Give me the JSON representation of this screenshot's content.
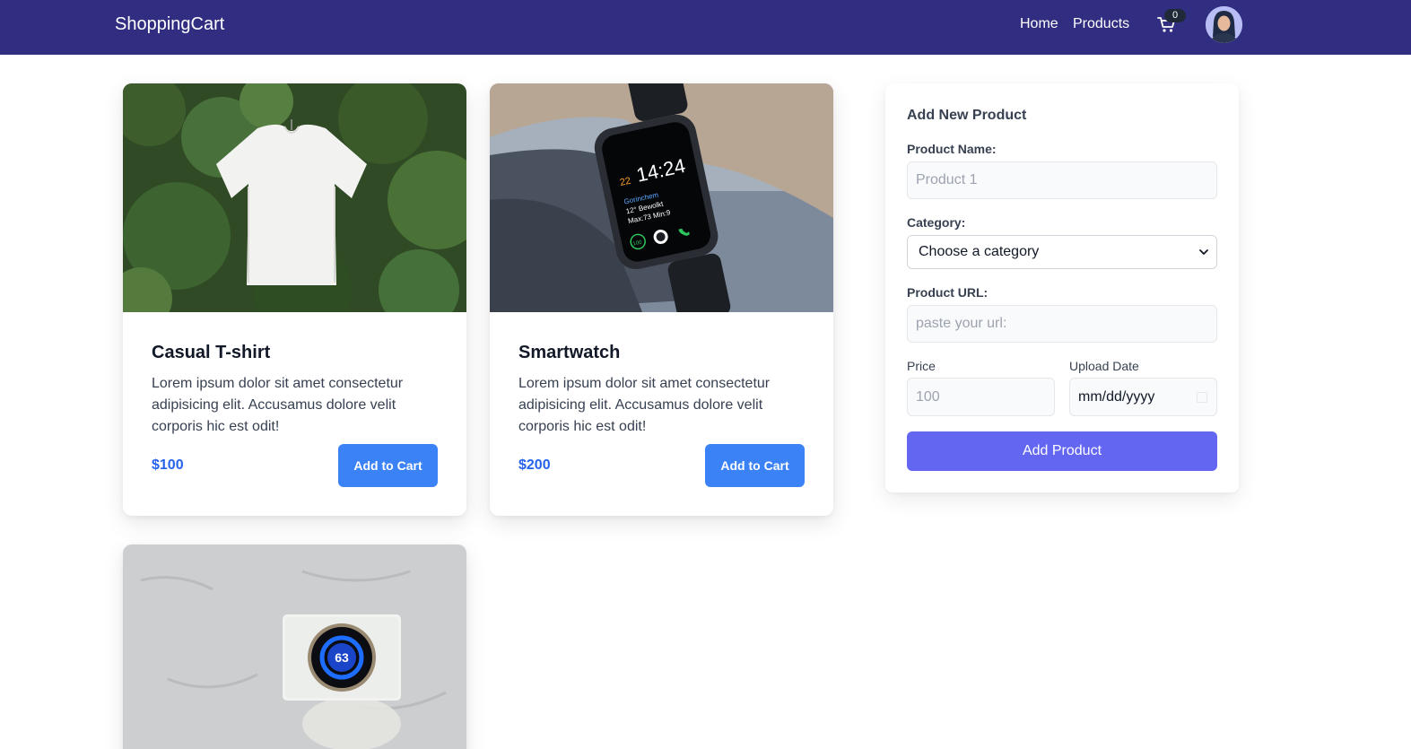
{
  "app": {
    "brand": "ShoppingCart"
  },
  "nav": {
    "links": [
      "Home",
      "Products"
    ],
    "cart_count": "0"
  },
  "products": [
    {
      "title": "Casual T-shirt",
      "description": "Lorem ipsum dolor sit amet consectetur adipisicing elit. Accusamus dolore velit corporis hic est odit!",
      "price": "$100",
      "button": "Add to Cart",
      "image": "white t-shirt hanging against green foliage"
    },
    {
      "title": "Smartwatch",
      "description": "Lorem ipsum dolor sit amet consectetur adipisicing elit. Accusamus dolore velit corporis hic est odit!",
      "price": "$200",
      "button": "Add to Cart",
      "image": "black smartwatch on wrist showing 14:24"
    },
    {
      "title": "",
      "description": "",
      "price": "",
      "button": "",
      "image": "smart thermostat on white wall showing 63"
    }
  ],
  "watch_face": {
    "time": "14:24",
    "day": "22",
    "city": "Gorinchem",
    "weather": "12° Bewolkt",
    "range": "Max:73 Min:9",
    "ring": "100"
  },
  "thermostat": {
    "temp": "63"
  },
  "form": {
    "title": "Add New Product",
    "name_label": "Product Name:",
    "name_placeholder": "Product 1",
    "category_label": "Category:",
    "category_value": "Choose a category",
    "url_label": "Product URL:",
    "url_placeholder": "paste your url:",
    "price_label": "Price",
    "price_placeholder": "100",
    "date_label": "Upload Date",
    "date_value": "mm/dd/yyyy",
    "submit": "Add Product"
  },
  "colors": {
    "navbar": "#312e81",
    "price": "#2563eb",
    "cart_button": "#3b82f6",
    "add_button": "#6366f1"
  },
  "icons": [
    "shopping-cart-icon",
    "chevron-down-icon",
    "calendar-icon"
  ]
}
